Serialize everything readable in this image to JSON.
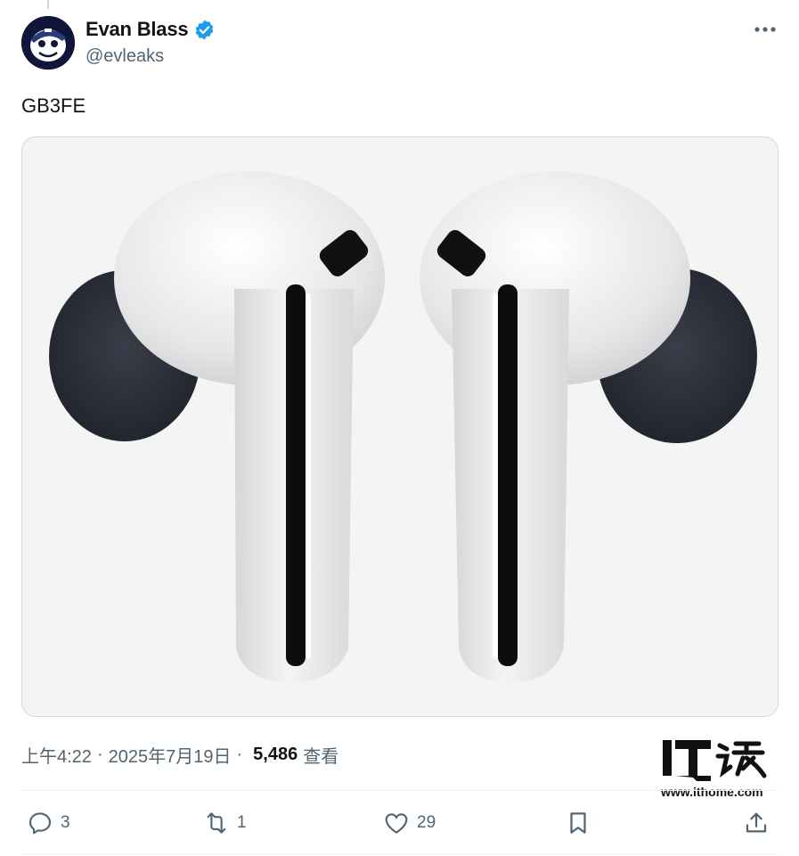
{
  "author": {
    "display_name": "Evan Blass",
    "handle": "@evleaks",
    "verified": true
  },
  "tweet": {
    "text": "GB3FE",
    "time": "上午4:22",
    "date": "2025年7月19日",
    "views_count": "5,486",
    "views_label": "查看",
    "separator": "·"
  },
  "media": {
    "subject": "earbuds-pair-image"
  },
  "actions": {
    "replies": "3",
    "retweets": "1",
    "likes": "29"
  },
  "watermark": {
    "url": "www.ithome.com"
  },
  "icons": [
    "more-icon",
    "verified-badge-icon",
    "reply-icon",
    "retweet-icon",
    "like-icon",
    "bookmark-icon",
    "share-icon"
  ],
  "colors": {
    "verified_blue": "#1d9bf0",
    "secondary_text": "#536471",
    "primary_text": "#0f1419",
    "earbud_tip": "#2b2e38"
  }
}
